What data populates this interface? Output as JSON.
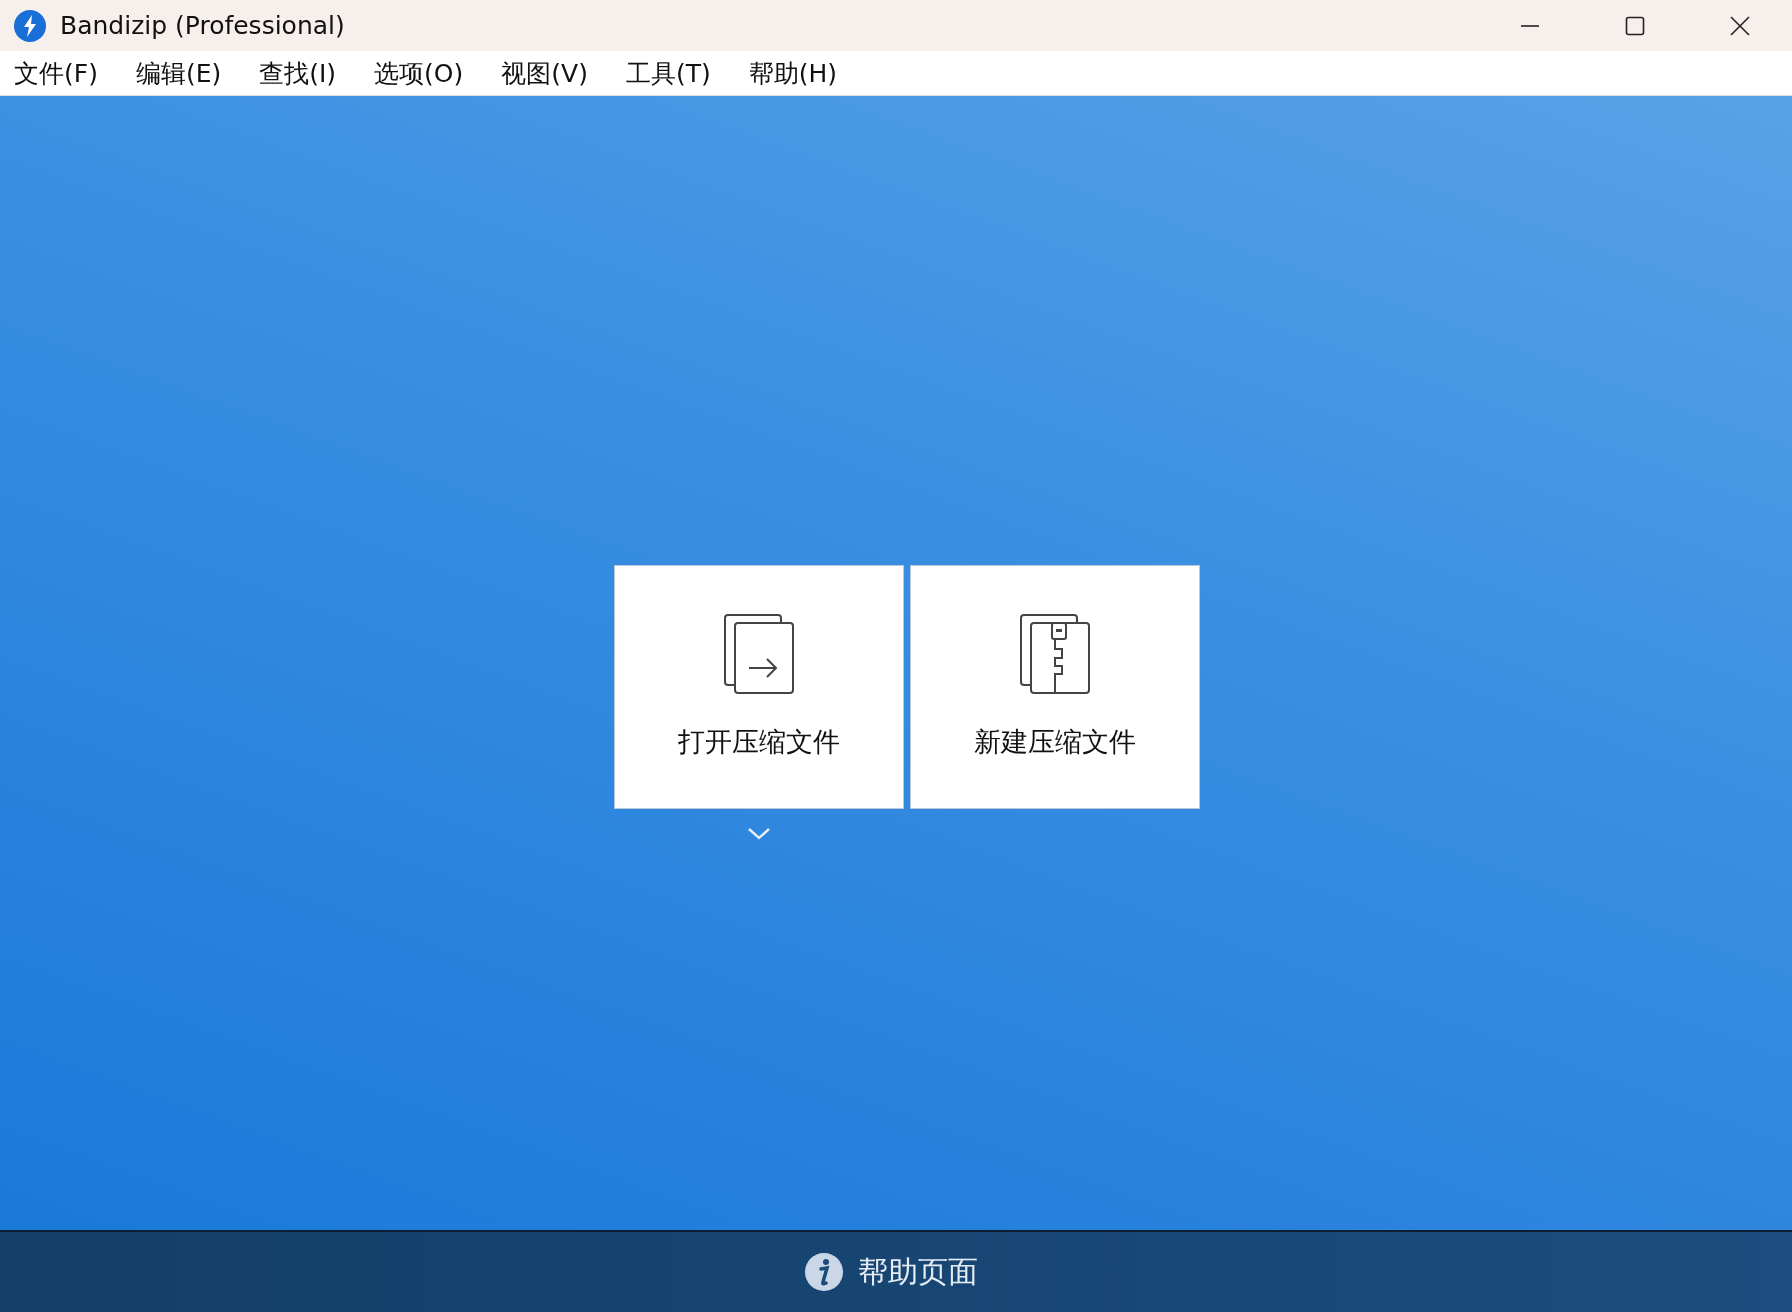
{
  "window": {
    "title": "Bandizip (Professional)"
  },
  "menu": [
    "文件(F)",
    "编辑(E)",
    "查找(I)",
    "选项(O)",
    "视图(V)",
    "工具(T)",
    "帮助(H)"
  ],
  "actions": [
    {
      "kind": "open",
      "label": "打开压缩文件"
    },
    {
      "kind": "new",
      "label": "新建压缩文件"
    }
  ],
  "footer": {
    "label": "帮助页面"
  }
}
